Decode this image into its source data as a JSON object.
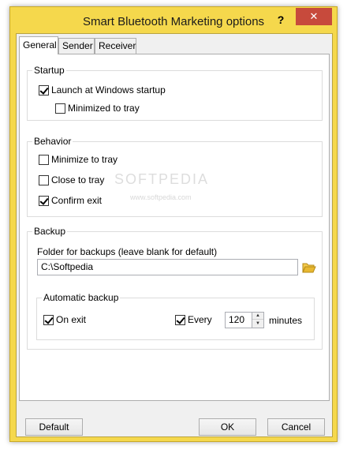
{
  "window": {
    "title": "Smart Bluetooth Marketing options",
    "help_label": "?",
    "close_label": "✕"
  },
  "tabs": [
    {
      "label": "General",
      "active": true
    },
    {
      "label": "Sender",
      "active": false
    },
    {
      "label": "Receiver",
      "active": false
    }
  ],
  "startup": {
    "title": "Startup",
    "launch_label": "Launch at Windows startup",
    "launch_checked": true,
    "minimized_label": "Minimized to tray",
    "minimized_checked": false
  },
  "behavior": {
    "title": "Behavior",
    "minimize_label": "Minimize to tray",
    "minimize_checked": false,
    "close_label": "Close to tray",
    "close_checked": false,
    "confirm_label": "Confirm exit",
    "confirm_checked": true
  },
  "backup": {
    "title": "Backup",
    "folder_label": "Folder for backups  (leave blank for default)",
    "folder_value": "C:\\Softpedia",
    "auto": {
      "title": "Automatic backup",
      "on_exit_label": "On exit",
      "on_exit_checked": true,
      "every_label": "Every",
      "every_checked": true,
      "interval_value": "120",
      "unit_label": "minutes"
    }
  },
  "watermark": {
    "text": "SOFTPEDIA",
    "sub": "www.softpedia.com"
  },
  "buttons": {
    "default_label": "Default",
    "ok_label": "OK",
    "cancel_label": "Cancel"
  },
  "colors": {
    "frame": "#f5d84c",
    "close_button": "#c74a3c",
    "folder_icon": "#e8b830"
  }
}
